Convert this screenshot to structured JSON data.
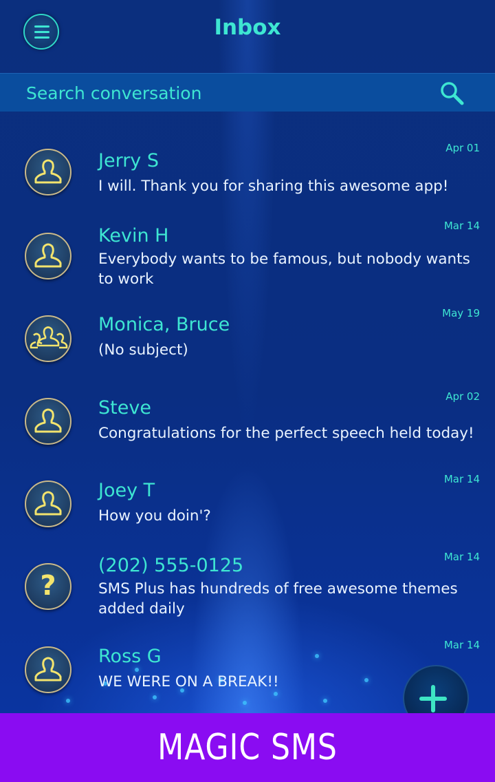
{
  "header": {
    "title": "Inbox"
  },
  "search": {
    "placeholder": "Search conversation"
  },
  "conversations": [
    {
      "name": "Jerry S",
      "message": "I will. Thank you for sharing this awesome app!",
      "date": "Apr 01",
      "avatar": "person-icon"
    },
    {
      "name": "Kevin H",
      "message": "Everybody wants to be famous, but nobody wants to work",
      "date": "Mar 14",
      "avatar": "person-icon"
    },
    {
      "name": "Monica, Bruce",
      "message": "(No subject)",
      "date": "May 19",
      "avatar": "group-icon"
    },
    {
      "name": "Steve",
      "message": "Congratulations for the perfect speech held today!",
      "date": "Apr 02",
      "avatar": "person-icon"
    },
    {
      "name": "Joey T",
      "message": "How you doin'?",
      "date": "Mar 14",
      "avatar": "person-icon"
    },
    {
      "name": "(202) 555-0125",
      "message": "SMS Plus has hundreds of free awesome themes added daily",
      "date": "Mar 14",
      "avatar": "unknown-contact-icon"
    },
    {
      "name": "Ross G",
      "message": "WE WERE ON A BREAK!!",
      "date": "Mar 14",
      "avatar": "person-icon"
    }
  ],
  "banner": {
    "text": "MAGIC SMS"
  },
  "colors": {
    "accent": "#3ee6d2",
    "banner": "#8a0cf2",
    "avatar_icon": "#f3e46d"
  }
}
